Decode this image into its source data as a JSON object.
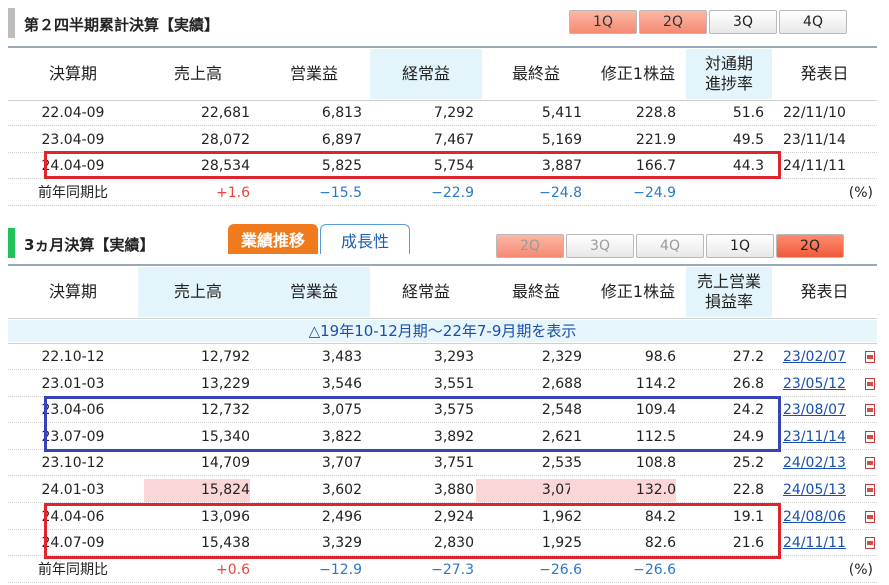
{
  "cumulative": {
    "title": "第２四半期累計決算【実績】",
    "qtabs": [
      "1Q",
      "2Q",
      "3Q",
      "4Q"
    ],
    "headers": [
      "決算期",
      "売上高",
      "営業益",
      "経常益",
      "最終益",
      "修正1株益",
      "対通期\n進捗率",
      "発表日"
    ],
    "rows": [
      [
        "22.04-09",
        "22,681",
        "6,813",
        "7,292",
        "5,411",
        "228.8",
        "51.6",
        "22/11/10"
      ],
      [
        "23.04-09",
        "28,072",
        "6,897",
        "7,467",
        "5,169",
        "221.9",
        "49.5",
        "23/11/14"
      ],
      [
        "24.04-09",
        "28,534",
        "5,825",
        "5,754",
        "3,887",
        "166.7",
        "44.3",
        "24/11/11"
      ]
    ],
    "yoy": [
      "前年同期比",
      "+1.6",
      "−15.5",
      "−22.9",
      "−24.8",
      "−24.9",
      "",
      "(%)"
    ]
  },
  "quarterly": {
    "title": "3ヵ月決算【実績】",
    "tab_active": "業績推移",
    "tab_inactive": "成長性",
    "qtabs": [
      "2Q",
      "3Q",
      "4Q",
      "1Q",
      "2Q"
    ],
    "headers": [
      "決算期",
      "売上高",
      "営業益",
      "経常益",
      "最終益",
      "修正1株益",
      "売上営業\n損益率",
      "発表日"
    ],
    "notice": "△19年10-12月期～22年7-9月期を表示",
    "rows": [
      [
        "22.10-12",
        "12,792",
        "3,483",
        "3,293",
        "2,329",
        "98.6",
        "27.2",
        "23/02/07"
      ],
      [
        "23.01-03",
        "13,229",
        "3,546",
        "3,551",
        "2,688",
        "114.2",
        "26.8",
        "23/05/12"
      ],
      [
        "23.04-06",
        "12,732",
        "3,075",
        "3,575",
        "2,548",
        "109.4",
        "24.2",
        "23/08/07"
      ],
      [
        "23.07-09",
        "15,340",
        "3,822",
        "3,892",
        "2,621",
        "112.5",
        "24.9",
        "23/11/14"
      ],
      [
        "23.10-12",
        "14,709",
        "3,707",
        "3,751",
        "2,535",
        "108.8",
        "25.2",
        "24/02/13"
      ],
      [
        "24.01-03",
        "15,824",
        "3,602",
        "3,880",
        "3,076",
        "132.0",
        "22.8",
        "24/05/13"
      ],
      [
        "24.04-06",
        "13,096",
        "2,496",
        "2,924",
        "1,962",
        "84.2",
        "19.1",
        "24/08/06"
      ],
      [
        "24.07-09",
        "15,438",
        "3,329",
        "2,830",
        "1,925",
        "82.6",
        "21.6",
        "24/11/11"
      ]
    ],
    "yoy": [
      "前年同期比",
      "+0.6",
      "−12.9",
      "−27.3",
      "−26.6",
      "−26.6",
      "",
      "(%)"
    ]
  },
  "colors": {
    "positive": "#e8453c",
    "negative": "#2a79c9",
    "highlight_red": "#e0242b",
    "highlight_blue": "#3a42b8",
    "header_shade": "#e3f5fb",
    "max_pink": "#fbd6d6"
  }
}
